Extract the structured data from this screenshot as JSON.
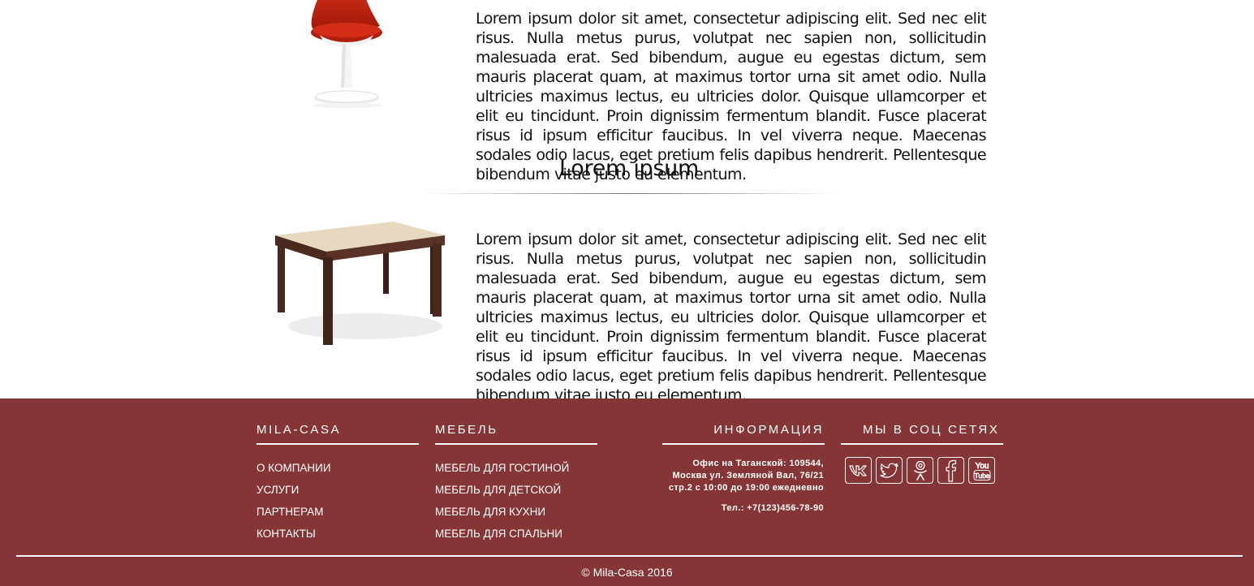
{
  "content": {
    "para1": "Lorem ipsum dolor sit amet, consectetur adipiscing elit. Sed nec elit risus. Nulla metus purus, volutpat nec sapien non, sollicitudin malesuada erat. Sed bibendum, augue eu egestas dictum, sem mauris placerat quam, at maximus tortor urna sit amet odio. Nulla ultricies maximus lectus, eu ultricies dolor. Quisque ullamcorper et elit eu tincidunt. Proin dignissim fermentum blandit. Fusce placerat risus id ipsum efficitur faucibus. In vel viverra neque. Maecenas sodales odio lacus, eget pretium felis dapibus hendrerit. Pellentesque bibendum vitae justo eu elementum.",
    "section_title": "Lorem ipsum",
    "para2": "Lorem ipsum dolor sit amet, consectetur adipiscing elit. Sed nec elit risus. Nulla metus purus, volutpat nec sapien non, sollicitudin malesuada erat. Sed bibendum, augue eu egestas dictum, sem mauris placerat quam, at maximus tortor urna sit amet odio. Nulla ultricies maximus lectus, eu ultricies dolor. Quisque ullamcorper et elit eu tincidunt. Proin dignissim fermentum blandit. Fusce placerat risus id ipsum efficitur faucibus. In vel viverra neque. Maecenas sodales odio lacus, eget pretium felis dapibus hendrerit. Pellentesque bibendum vitae justo eu elementum."
  },
  "footer": {
    "col1": {
      "heading": "MILA-CASA",
      "links": [
        "О КОМПАНИИ",
        "УСЛУГИ",
        "ПАРТНЕРАМ",
        "КОНТАКТЫ"
      ]
    },
    "col2": {
      "heading": "МЕБЕЛЬ",
      "links": [
        "МЕБЕЛЬ ДЛЯ ГОСТИНОЙ",
        "МЕБЕЛЬ ДЛЯ ДЕТСКОЙ",
        "МЕБЕЛЬ ДЛЯ КУХНИ",
        "МЕБЕЛЬ ДЛЯ СПАЛЬНИ"
      ]
    },
    "col3": {
      "heading": "ИНФОРМАЦИЯ",
      "address": "Офис на Таганской: 109544, Москва ул. Земляной Вал, 76/21 стр.2 с 10:00 до 19:00 ежедневно",
      "phone": "Тел.: +7(123)456-78-90"
    },
    "col4": {
      "heading": "МЫ В СОЦ СЕТЯХ",
      "socials": [
        "vk-icon",
        "twitter-icon",
        "odnoklassniki-icon",
        "facebook-icon",
        "youtube-icon"
      ]
    },
    "copyright": "© Mila-Casa 2016"
  },
  "colors": {
    "footer_bg": "#853536",
    "chair_red": "#c0200f",
    "table_wood": "#4a2a1f",
    "table_top": "#e8dcc4"
  }
}
